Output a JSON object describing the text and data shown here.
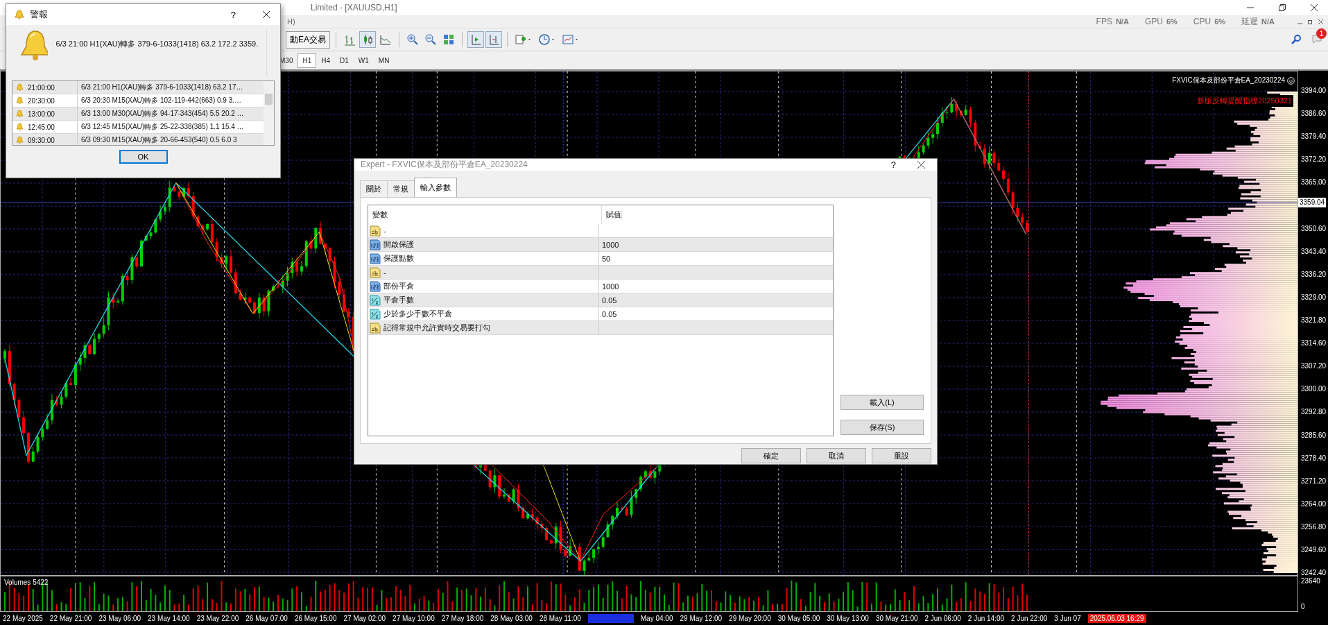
{
  "window": {
    "title": "Limited - [XAUUSD,H1]"
  },
  "menu_bar": {
    "item": "H)"
  },
  "status": [
    {
      "label": "FPS",
      "value": "N/A"
    },
    {
      "label": "GPU",
      "value": "6%"
    },
    {
      "label": "CPU",
      "value": "6%"
    },
    {
      "label": "延遲",
      "value": "N/A"
    }
  ],
  "toolbar": {
    "ea_button": "動EA交易",
    "notification_count": "1"
  },
  "timeframes": [
    {
      "label": "M30",
      "selected": false
    },
    {
      "label": "H1",
      "selected": true
    },
    {
      "label": "H4",
      "selected": false
    },
    {
      "label": "D1",
      "selected": false
    },
    {
      "label": "W1",
      "selected": false
    },
    {
      "label": "MN",
      "selected": false
    }
  ],
  "chart": {
    "indicator_label": "FXVIC保本及部份平倉EA_20230224",
    "signal_label": "新版反轉提醒指標20250321",
    "current_price": "3359.04",
    "price_ticks": [
      "3394.00",
      "3386.60",
      "3379.40",
      "3372.20",
      "3365.00",
      "3350.60",
      "3343.40",
      "3336.20",
      "3329.00",
      "3321.80",
      "3314.60",
      "3307.20",
      "3300.00",
      "3292.80",
      "3285.60",
      "3278.40",
      "3271.20",
      "3264.00",
      "3256.80",
      "3249.60",
      "3242.40"
    ],
    "volume_label": "Volumes 5422",
    "volume_ticks": [
      "23640",
      "0"
    ],
    "time_labels": [
      "22 May 2025",
      "22 May 21:00",
      "23 May 06:00",
      "23 May 14:00",
      "23 May 22:00",
      "26 May 07:00",
      "26 May 15:00",
      "27 May 02:00",
      "27 May 10:00",
      "27 May 18:00",
      "28 May 03:00",
      "28 May 11:00",
      "May 04:00",
      "29 May 12:00",
      "29 May 20:00",
      "30 May 05:00",
      "30 May 13:00",
      "30 May 21:00",
      "2 Jun 06:00",
      "2 Jun 14:00",
      "2 Jun 22:00",
      "3 Jun 07"
    ],
    "time_marker": "2025.06.03 16:29"
  },
  "alert_dialog": {
    "title": "警報",
    "message": "6/3 21:00 H1(XAU)轉多 379-6-1033(1418) 63.2 172.2 3359.",
    "rows": [
      {
        "time": "21:00:00",
        "text": "6/3 21:00 H1(XAU)轉多 379-6-1033(1418) 63.2 17…"
      },
      {
        "time": "20:30:00",
        "text": "6/3 20:30 M15(XAU)轉多 102-119-442(663) 0.9 3.…"
      },
      {
        "time": "13:00:00",
        "text": "6/3 13:00 M30(XAU)轉多 94-17-343(454) 5.5 20.2 …"
      },
      {
        "time": "12:45:00",
        "text": "6/3 12:45 M15(XAU)轉多 25-22-338(385) 1.1 15.4 …"
      },
      {
        "time": "09:30:00",
        "text": "6/3 09:30 M15(XAU)轉多 20-66-453(540) 0.5 6.0 3"
      }
    ],
    "button": "OK",
    "help": "?"
  },
  "expert_dialog": {
    "title": "Expert - FXVIC保本及部份平倉EA_20230224",
    "tabs": [
      {
        "label": "關於",
        "selected": false
      },
      {
        "label": "常規",
        "selected": false
      },
      {
        "label": "輸入參數",
        "selected": true
      }
    ],
    "columns": [
      "變數",
      "賦值"
    ],
    "rows": [
      {
        "kind": "string",
        "name": "-"
      },
      {
        "kind": "int",
        "name": "開啟保護",
        "value": "1000"
      },
      {
        "kind": "int",
        "name": "保護點數",
        "value": "50"
      },
      {
        "kind": "string",
        "name": "-"
      },
      {
        "kind": "int",
        "name": "部份平倉",
        "value": "1000"
      },
      {
        "kind": "double",
        "name": "平倉手數",
        "value": "0.05"
      },
      {
        "kind": "double",
        "name": "少於多少手數不平倉",
        "value": "0.05"
      },
      {
        "kind": "string",
        "name": "記得常規中允許實時交易要打勾"
      }
    ],
    "side_buttons": [
      "載入(L)",
      "保存(S)"
    ],
    "buttons": [
      "確定",
      "取消",
      "重設"
    ],
    "help": "?"
  }
}
